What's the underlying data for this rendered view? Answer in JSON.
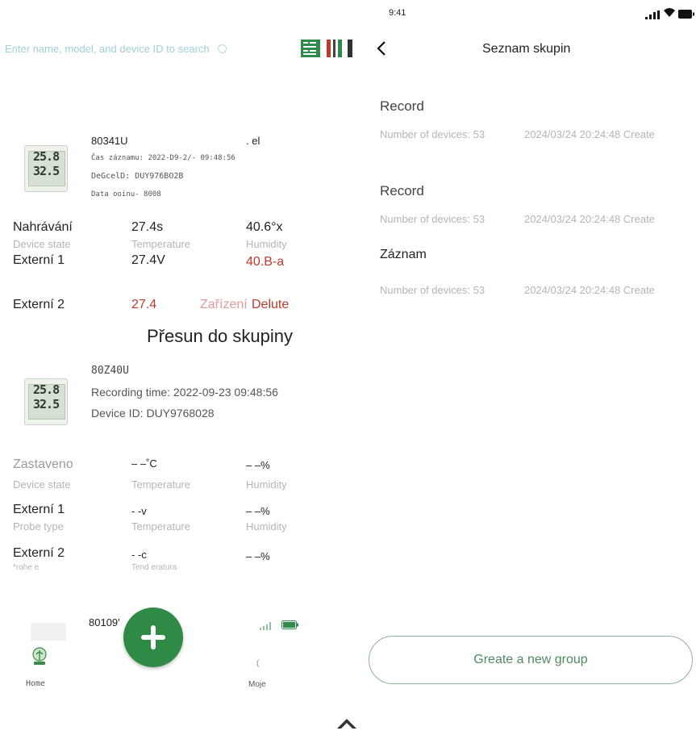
{
  "left": {
    "search_placeholder": "Enter name, model, and device ID to search",
    "device1": {
      "model": "80341U",
      "model_suffix": ". el",
      "lcd_top": "25.8",
      "lcd_bottom": "32.5",
      "record_time": "Čas záznamu: 2022-D9-2/- 09:48:56",
      "device_id": "DeGcelD: DUY976BO2B",
      "data_line": "Data ooinu- 8008",
      "row1": {
        "label": "Nahrávání",
        "temp": "27.4s",
        "hum": "40.6°x"
      },
      "row1_captions": {
        "state": "Device state",
        "temp": "Temperature",
        "hum": "Humidity"
      },
      "row2": {
        "label": "Externí 1",
        "temp": "27.4V",
        "hum": "40.B-a"
      },
      "row3": {
        "label": "Externí 2",
        "temp": "27.4",
        "action1": "Zařízení",
        "action2": "Delute"
      },
      "move_to_group": "Přesun do skupiny"
    },
    "device2": {
      "model": "80Z40U",
      "lcd_top": "25.8",
      "lcd_bottom": "32.5",
      "record_time": "Recording time: 2022-09-23 09:48:56",
      "device_id": "Device ID: DUY9768028",
      "row1": {
        "label": "Zastaveno",
        "temp": "– –˚C",
        "hum": "– –%"
      },
      "row1_captions": {
        "state": "Device state",
        "temp": "Temperature",
        "hum": "Humidity"
      },
      "row2": {
        "label": "Externí 1",
        "temp": "- -v",
        "hum": "– –%"
      },
      "row2_captions": {
        "state": "Probe type",
        "temp": "Temperature",
        "hum": "Humidity"
      },
      "row3": {
        "label": "Externí 2",
        "temp": "- -c",
        "hum": "– –%"
      },
      "row3_captions": {
        "state": "*rohe e",
        "temp": "Tend eratura"
      }
    },
    "device3": {
      "model": "80109'"
    },
    "nav": {
      "home": "Home",
      "mine": "Moje",
      "mine_glyph": "("
    }
  },
  "right": {
    "status_time": "9:41",
    "title": "Seznam skupin",
    "groups": [
      {
        "name": "Record",
        "count": "Number of devices: 53",
        "created": "2024/03/24 20:24:48 Create"
      },
      {
        "name": "Record",
        "count": "Number of devices: 53",
        "created": "2024/03/24 20:24:48 Create"
      },
      {
        "name": "Záznam",
        "count": "Number of devices: 53",
        "created": "2024/03/24 20:24:48 Create"
      }
    ],
    "create_button": "Greate a new group"
  },
  "colors": {
    "accent_green": "#2f8a45",
    "error_red": "#c0392b",
    "button_border": "#8fb39a"
  }
}
